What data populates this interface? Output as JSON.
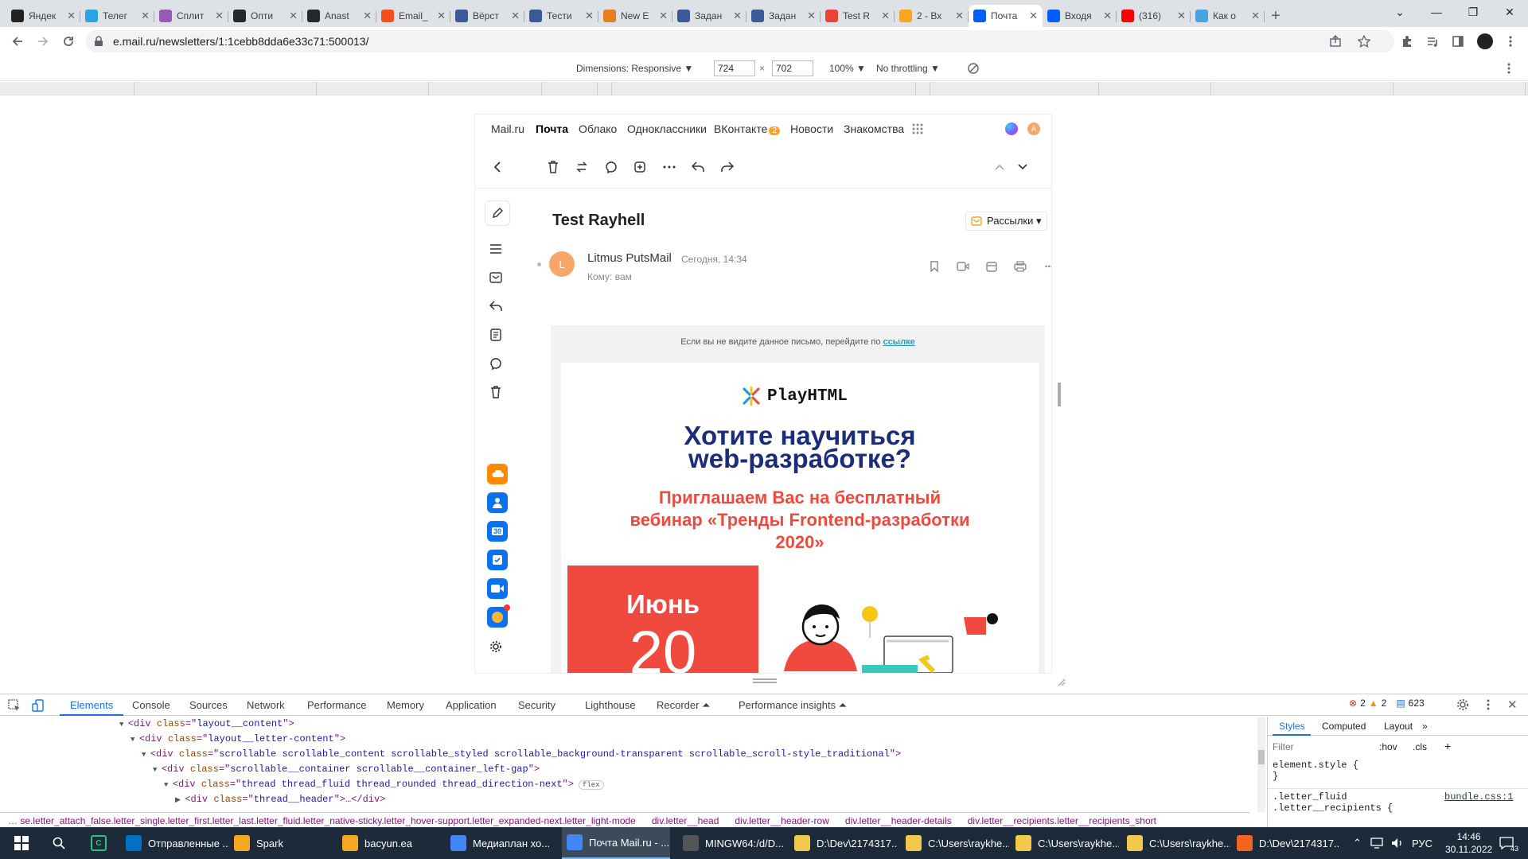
{
  "browser": {
    "tabs": [
      {
        "title": "Яндек",
        "color": "#222"
      },
      {
        "title": "Телег",
        "color": "#2aa3e0"
      },
      {
        "title": "Сплит",
        "color": "#9b59b6"
      },
      {
        "title": "Опти",
        "color": "#24292e"
      },
      {
        "title": "Anast",
        "color": "#24292e"
      },
      {
        "title": "Email_",
        "color": "#f24e1e"
      },
      {
        "title": "Вёрст",
        "color": "#3b5998"
      },
      {
        "title": "Тести",
        "color": "#3b5998"
      },
      {
        "title": "New E",
        "color": "#e67e22"
      },
      {
        "title": "Задан",
        "color": "#3b5998"
      },
      {
        "title": "Задан",
        "color": "#3b5998"
      },
      {
        "title": "Test R",
        "color": "#ea4335"
      },
      {
        "title": "2 - Вх",
        "color": "#f5a623"
      },
      {
        "title": "Почта",
        "color": "#005ff9"
      },
      {
        "title": "Входя",
        "color": "#005ff9"
      },
      {
        "title": "(316)",
        "color": "#ff0000"
      },
      {
        "title": "Как о",
        "color": "#4aa3df"
      }
    ],
    "active_tab_index": 13,
    "url": "e.mail.ru/newsletters/1:1cebb8dda6e33c71:500013/"
  },
  "device_toolbar": {
    "dimensions_label": "Dimensions: Responsive ▼",
    "width": "724",
    "times": "×",
    "height": "702",
    "zoom": "100% ▼",
    "throttling": "No throttling ▼"
  },
  "mail": {
    "nav": [
      "Mail.ru",
      "Почта",
      "Облако",
      "Одноклассники",
      "ВКонтакте",
      "Новости",
      "Знакомства"
    ],
    "vk_badge": "2",
    "avatar_letter": "A",
    "subject": "Test Rayhell",
    "folder_label": "Рассылки ▾",
    "sender_initial": "L",
    "sender_name": "Litmus PutsMail",
    "date": "Сегодня, 14:34",
    "to": "Кому: вам",
    "calendar_day": "30",
    "letter": {
      "preheader": "Если вы не видите данное письмо, перейдите по",
      "preheader_link": "ссылке",
      "logo": "PlayHTML",
      "headline1": "Хотите научиться",
      "headline2": "web-разработке?",
      "invite1": "Приглашаем Вас на бесплатный",
      "invite2": "вебинар «Тренды Frontend-разработки",
      "invite3": "2020»",
      "month": "Июнь",
      "day": "20"
    },
    "colors": {
      "headline": "#1b2d7a",
      "invite": "#f0493e",
      "date_block": "#f0493e"
    }
  },
  "devtools": {
    "tabs": [
      "Elements",
      "Console",
      "Sources",
      "Network",
      "Performance",
      "Memory",
      "Application",
      "Security",
      "Lighthouse",
      "Recorder ⏶",
      "Performance insights ⏶"
    ],
    "errors": "2",
    "warnings": "2",
    "messages": "623",
    "dom_lines": [
      {
        "tag": "div",
        "cls": "layout__content",
        "tail": ">"
      },
      {
        "tag": "div",
        "cls": "layout__letter-content",
        "tail": ">"
      },
      {
        "tag": "div",
        "cls": "scrollable scrollable_content scrollable_styled scrollable_background-transparent scrollable_scroll-style_traditional",
        "tail": ">"
      },
      {
        "tag": "div",
        "cls": "scrollable__container scrollable__container_left-gap",
        "tail": ">"
      },
      {
        "tag": "div",
        "cls": "thread thread_fluid thread_rounded thread_direction-next",
        "tail": ">"
      },
      {
        "tag": "div",
        "cls": "thread__header",
        "tail": ">…</div>"
      }
    ],
    "flex_badge": "flex",
    "breadcrumbs": [
      "se.letter_attach_false.letter_single.letter_first.letter_last.letter_fluid.letter_native-sticky.letter_hover-support.letter_expanded-next.letter_light-mode",
      "div.letter__head",
      "div.letter__header-row",
      "div.letter__header-details",
      "div.letter__recipients.letter__recipients_short"
    ],
    "styles_tabs": [
      "Styles",
      "Computed",
      "Layout",
      "»"
    ],
    "filter_placeholder": "Filter",
    "hov": ":hov",
    "cls": ".cls",
    "rule1": "element.style {",
    "rule1_end": "}",
    "rule2_sel": ".letter_fluid",
    "rule2_sel2": ".letter__recipients {",
    "rule2_src": "bundle.css:1"
  },
  "taskbar": {
    "items": [
      {
        "label": "Отправленные ...",
        "color": "#0072c6"
      },
      {
        "label": "Spark",
        "color": "#f5a623"
      },
      {
        "label": "bacyun.ea",
        "color": "#f5a623"
      },
      {
        "label": "Медиаплан хо...",
        "color": "#4285f4"
      },
      {
        "label": "Почта Mail.ru - ...",
        "color": "#4285f4"
      },
      {
        "label": "MINGW64:/d/D...",
        "color": "#555"
      },
      {
        "label": "D:\\Dev\\2174317...",
        "color": "#f2c94c"
      },
      {
        "label": "C:\\Users\\raykhe...",
        "color": "#f2c94c"
      },
      {
        "label": "C:\\Users\\raykhe...",
        "color": "#f2c94c"
      },
      {
        "label": "C:\\Users\\raykhe...",
        "color": "#f2c94c"
      },
      {
        "label": "D:\\Dev\\2174317...",
        "color": "#f26522"
      }
    ],
    "active_index": 4,
    "lang": "РУС",
    "time": "14:46",
    "date": "30.11.2022",
    "notif": "43"
  }
}
